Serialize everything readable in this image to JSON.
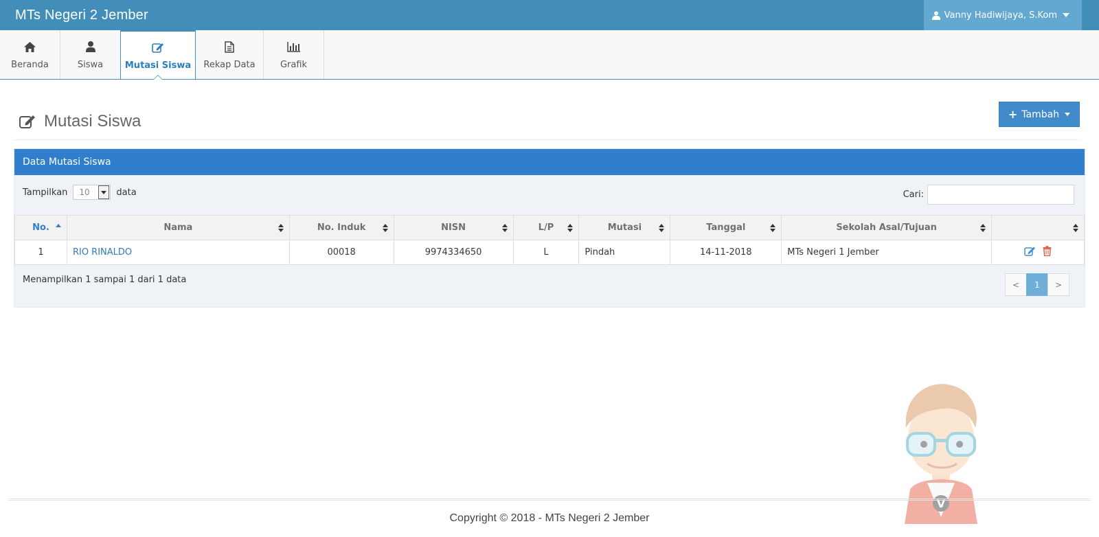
{
  "app": {
    "title": "MTs Negeri 2 Jember"
  },
  "user": {
    "name": "Vanny Hadiwijaya, S.Kom"
  },
  "menu": [
    {
      "label": "Beranda",
      "icon": "home-icon"
    },
    {
      "label": "Siswa",
      "icon": "user-icon"
    },
    {
      "label": "Mutasi Siswa",
      "icon": "edit-icon",
      "active": true
    },
    {
      "label": "Rekap Data",
      "icon": "document-icon"
    },
    {
      "label": "Grafik",
      "icon": "bar-chart-icon"
    }
  ],
  "page": {
    "title": "Mutasi Siswa",
    "add_label": "Tambah"
  },
  "panel": {
    "title": "Data Mutasi Siswa",
    "show_label": "Tampilkan",
    "show_value": "10",
    "show_suffix": "data",
    "search_label": "Cari:",
    "search_value": ""
  },
  "table": {
    "headers": [
      "No.",
      "Nama",
      "No. Induk",
      "NISN",
      "L/P",
      "Mutasi",
      "Tanggal",
      "Sekolah Asal/Tujuan",
      ""
    ],
    "rows": [
      {
        "no": "1",
        "nama": "RIO RINALDO",
        "induk": "00018",
        "nisn": "9974334650",
        "lp": "L",
        "mutasi": "Pindah",
        "tanggal": "14-11-2018",
        "sekolah": "MTs Negeri 1 Jember"
      }
    ]
  },
  "info": "Menampilkan 1 sampai 1 dari 1 data",
  "pagination": {
    "prev": "<",
    "current": "1",
    "next": ">"
  },
  "footer": "Copyright © 2018 - MTs Negeri 2 Jember",
  "colors": {
    "navbar": "#438eb9",
    "panel_head": "#307ecc",
    "button": "#428bca"
  }
}
